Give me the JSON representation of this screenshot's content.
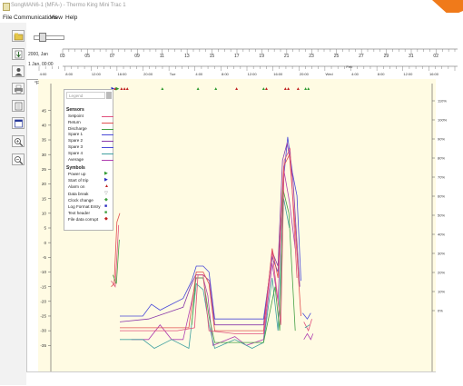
{
  "window": {
    "title": "SongMAN6-1 (MFA-) - Thermo King Mini Trac 1"
  },
  "menu": [
    "File",
    "Communications",
    "View",
    "Help"
  ],
  "toolbar": [
    "open-file-icon",
    "download-icon",
    "user-icon",
    "print-icon",
    "page-icon",
    "report-icon",
    "zoom-in-icon",
    "zoom-out-icon"
  ],
  "timeline": {
    "year_label": "2000, Jan",
    "start_label": "1 Jan, 00:00",
    "days": [
      "03",
      "05",
      "07",
      "09",
      "11",
      "13",
      "15",
      "17",
      "19",
      "21",
      "23",
      "25",
      "27",
      "29",
      "31",
      "02"
    ],
    "day_month_marker": "Feb",
    "hours": [
      "4:00",
      "8:00",
      "12:00",
      "16:00",
      "20:00",
      "Tue",
      "4:00",
      "8:00",
      "12:00",
      "16:00",
      "20:00",
      "Wed",
      "4:00",
      "8:00",
      "12:00",
      "16:00"
    ]
  },
  "y_axis": {
    "left_unit": "°F",
    "left_ticks": [
      "45",
      "40",
      "35",
      "30",
      "25",
      "20",
      "15",
      "10",
      "5",
      "0",
      "-5",
      "-10",
      "-15",
      "-20",
      "-25",
      "-30",
      "-35"
    ],
    "right_ticks": [
      "110%",
      "100%",
      "90%",
      "80%",
      "70%",
      "60%",
      "50%",
      "40%",
      "30%",
      "20%",
      "10%",
      "0%"
    ]
  },
  "legend": {
    "header": "Legend",
    "sensors_title": "Sensors",
    "sensors": [
      {
        "name": "Setpoint",
        "color": "#e0507c"
      },
      {
        "name": "Return",
        "color": "#e05050"
      },
      {
        "name": "Discharge",
        "color": "#45a045"
      },
      {
        "name": "Spare 1",
        "color": "#4a4ad8"
      },
      {
        "name": "Spare 2",
        "color": "#8a3aaa"
      },
      {
        "name": "Spare 3",
        "color": "#4a4ad8"
      },
      {
        "name": "Spare 4",
        "color": "#40a0a0"
      },
      {
        "name": "Average",
        "color": "#b040b0"
      }
    ],
    "symbols_title": "Symbols",
    "symbols": [
      {
        "name": "Power up",
        "glyph": "▶",
        "color": "#2f9a2f"
      },
      {
        "name": "Start of trip",
        "glyph": "▶",
        "color": "#2a2ac0"
      },
      {
        "name": "Alarm on",
        "glyph": "▲",
        "color": "#c02020"
      },
      {
        "name": "Data break",
        "glyph": "▽",
        "color": "#888888"
      },
      {
        "name": "Clock change",
        "glyph": "◆",
        "color": "#40a040"
      },
      {
        "name": "Log Format Entry",
        "glyph": "■",
        "color": "#2a2ac0"
      },
      {
        "name": "Text header",
        "glyph": "■",
        "color": "#40a040"
      },
      {
        "name": "File data corrupt",
        "glyph": "◆",
        "color": "#c02020"
      }
    ]
  },
  "chart_data": {
    "type": "line",
    "ylabel": "°F",
    "ylim": [
      -38,
      48
    ],
    "x_unit": "hours since 1 Jan 00:00",
    "xlim": [
      0,
      66
    ],
    "grid": false,
    "series": [
      {
        "name": "Return",
        "color": "#e05050",
        "points": [
          [
            10.5,
            -15
          ],
          [
            11.0,
            -14
          ],
          [
            11.5,
            7
          ],
          [
            12.0,
            10
          ]
        ]
      },
      {
        "name": "Setpoint",
        "color": "#e0507c",
        "points": [
          [
            10.5,
            -13
          ],
          [
            11.2,
            -15
          ],
          [
            11.8,
            6
          ]
        ]
      },
      {
        "name": "Discharge",
        "color": "#45a045",
        "points": [
          [
            10.8,
            -11
          ],
          [
            11.4,
            -14
          ],
          [
            11.9,
            1
          ]
        ]
      },
      {
        "name": "Spare 1",
        "color": "#4a4ad8",
        "points": [
          [
            12,
            -25
          ],
          [
            16,
            -25
          ],
          [
            17.5,
            -21
          ],
          [
            19,
            -23
          ],
          [
            21,
            -21
          ],
          [
            23,
            -19
          ],
          [
            24.5,
            -13
          ],
          [
            25.3,
            -8
          ],
          [
            26.5,
            -8
          ],
          [
            27.5,
            -10
          ],
          [
            28.5,
            -26
          ],
          [
            32,
            -26
          ],
          [
            37,
            -26
          ],
          [
            38.5,
            -5
          ],
          [
            39.5,
            -10
          ],
          [
            40.5,
            22
          ],
          [
            41.2,
            36
          ],
          [
            42,
            24
          ],
          [
            42.8,
            16
          ],
          [
            43.5,
            -13
          ]
        ]
      },
      {
        "name": "Spare 2",
        "color": "#8a3aaa",
        "points": [
          [
            12,
            -27
          ],
          [
            17,
            -26
          ],
          [
            20,
            -24
          ],
          [
            23,
            -22
          ],
          [
            24.3,
            -15
          ],
          [
            25.2,
            -11
          ],
          [
            26.5,
            -11
          ],
          [
            27.6,
            -13
          ],
          [
            28.5,
            -28
          ],
          [
            33,
            -28
          ],
          [
            37,
            -28
          ],
          [
            38.5,
            -3
          ],
          [
            39.5,
            -8
          ],
          [
            40.3,
            28
          ],
          [
            41.1,
            34
          ],
          [
            42.1,
            22
          ],
          [
            43.3,
            -15
          ]
        ]
      },
      {
        "name": "Average",
        "color": "#b040b0",
        "points": [
          [
            14,
            -33
          ],
          [
            17,
            -33
          ],
          [
            19,
            -28
          ],
          [
            21,
            -33
          ],
          [
            23,
            -33
          ],
          [
            24.5,
            -20
          ],
          [
            25.3,
            -12
          ],
          [
            26.5,
            -12
          ],
          [
            27.3,
            -18
          ],
          [
            28.2,
            -35
          ],
          [
            32,
            -32
          ],
          [
            34,
            -35
          ],
          [
            37,
            -33
          ],
          [
            38.5,
            -7
          ],
          [
            39.5,
            -20
          ],
          [
            40.5,
            25
          ],
          [
            41.5,
            14
          ],
          [
            42.5,
            -2
          ]
        ]
      },
      {
        "name": "Spare 4",
        "color": "#40a0a0",
        "points": [
          [
            12,
            -33
          ],
          [
            16,
            -33
          ],
          [
            18,
            -36
          ],
          [
            21,
            -33
          ],
          [
            24,
            -36
          ],
          [
            25.3,
            -14
          ],
          [
            26.5,
            -16
          ],
          [
            27.5,
            -28
          ],
          [
            28.5,
            -36
          ],
          [
            32,
            -33
          ],
          [
            35,
            -36
          ],
          [
            37,
            -34
          ],
          [
            38.5,
            -12
          ],
          [
            39.5,
            -30
          ],
          [
            40.5,
            15
          ],
          [
            41.5,
            5
          ]
        ]
      },
      {
        "name": "Discharge",
        "color": "#45a045",
        "points": [
          [
            24.5,
            -28
          ],
          [
            25.2,
            -12
          ],
          [
            26.5,
            -12
          ],
          [
            27.5,
            -25
          ],
          [
            28.5,
            -34
          ],
          [
            32,
            -34
          ],
          [
            37,
            -34
          ],
          [
            39,
            -15
          ],
          [
            39.8,
            -30
          ],
          [
            40.4,
            18
          ],
          [
            41.4,
            10
          ],
          [
            42.5,
            -30
          ]
        ]
      },
      {
        "name": "Return",
        "color": "#e05050",
        "points": [
          [
            12,
            -29
          ],
          [
            16,
            -29
          ],
          [
            22,
            -29
          ],
          [
            24,
            -29
          ],
          [
            25.3,
            -10
          ],
          [
            26.5,
            -10
          ],
          [
            27.5,
            -14
          ],
          [
            28.5,
            -30
          ],
          [
            32,
            -30
          ],
          [
            37,
            -30
          ],
          [
            38.5,
            -2
          ],
          [
            39.5,
            -12
          ],
          [
            40.5,
            26
          ],
          [
            41.5,
            30
          ],
          [
            42.5,
            5
          ],
          [
            43.5,
            -25
          ]
        ]
      },
      {
        "name": "Setpoint",
        "color": "#e0507c",
        "points": [
          [
            12,
            -30
          ],
          [
            22,
            -30
          ],
          [
            25,
            -29
          ],
          [
            25.6,
            -11
          ],
          [
            26.5,
            -11
          ],
          [
            27.5,
            -30
          ],
          [
            32,
            -31
          ],
          [
            37,
            -31
          ],
          [
            38.5,
            -3
          ],
          [
            40,
            -28
          ],
          [
            40.6,
            28
          ],
          [
            41.6,
            32
          ],
          [
            42.8,
            -12
          ]
        ]
      },
      {
        "name": "Spare 3",
        "color": "#4a4ad8",
        "points": [
          [
            43.8,
            -24
          ],
          [
            44.6,
            -26
          ],
          [
            45.2,
            -24
          ]
        ]
      },
      {
        "name": "Setpoint",
        "color": "#e0507c",
        "points": [
          [
            44,
            -27
          ],
          [
            44.8,
            -30
          ],
          [
            45.4,
            -26
          ]
        ]
      },
      {
        "name": "Average",
        "color": "#b040b0",
        "points": [
          [
            44,
            -33
          ],
          [
            44.6,
            -31
          ],
          [
            45.2,
            -33
          ],
          [
            45.6,
            -31
          ]
        ]
      },
      {
        "name": "Spare 4",
        "color": "#40a0a0",
        "points": [
          [
            44.2,
            -29
          ],
          [
            45,
            -28
          ]
        ]
      }
    ],
    "event_markers": [
      {
        "x": 10.8,
        "glyph": "▶",
        "color": "#2a2ac0"
      },
      {
        "x": 11.2,
        "glyph": "▲",
        "color": "#c02020"
      },
      {
        "x": 11.6,
        "glyph": "▶",
        "color": "#2f9a2f"
      },
      {
        "x": 12.3,
        "glyph": "▲",
        "color": "#c02020"
      },
      {
        "x": 12.8,
        "glyph": "▲",
        "color": "#c02020"
      },
      {
        "x": 13.3,
        "glyph": "▲",
        "color": "#c02020"
      },
      {
        "x": 19.4,
        "glyph": "▲",
        "color": "#2f9a2f"
      },
      {
        "x": 25.6,
        "glyph": "▲",
        "color": "#2f9a2f"
      },
      {
        "x": 28.7,
        "glyph": "▲",
        "color": "#2f9a2f"
      },
      {
        "x": 32.3,
        "glyph": "▲",
        "color": "#c02020"
      },
      {
        "x": 37.0,
        "glyph": "▲",
        "color": "#2f9a2f"
      },
      {
        "x": 37.5,
        "glyph": "▲",
        "color": "#c02020"
      },
      {
        "x": 40.8,
        "glyph": "▲",
        "color": "#c02020"
      },
      {
        "x": 41.3,
        "glyph": "▲",
        "color": "#c02020"
      },
      {
        "x": 43.0,
        "glyph": "▲",
        "color": "#c02020"
      },
      {
        "x": 44.3,
        "glyph": "▲",
        "color": "#2f9a2f"
      },
      {
        "x": 44.8,
        "glyph": "▲",
        "color": "#2f9a2f"
      }
    ]
  }
}
